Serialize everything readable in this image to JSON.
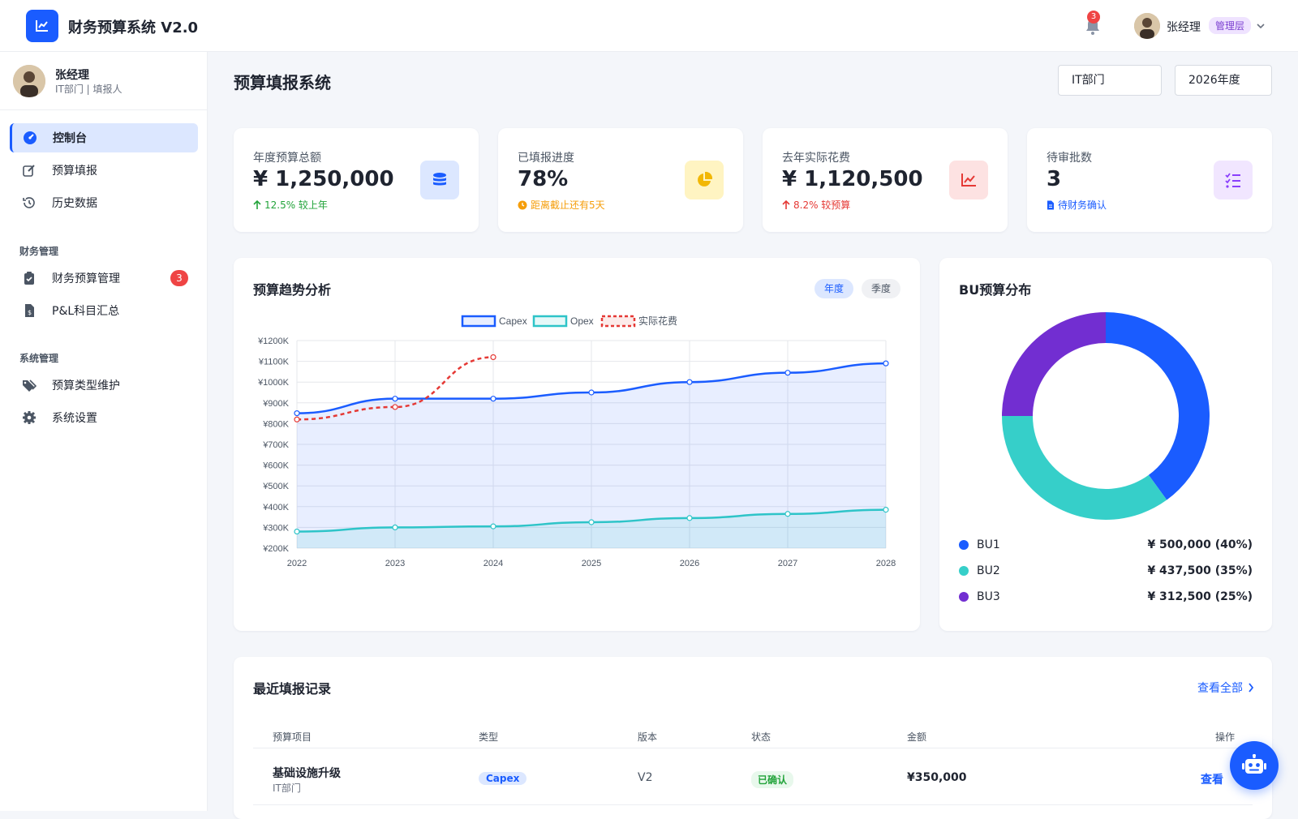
{
  "app": {
    "title": "财务预算系统 V2.0"
  },
  "topbar": {
    "notification_count": "3",
    "user_name": "张经理",
    "role": "管理层"
  },
  "sidebar": {
    "user_name": "张经理",
    "user_sub": "IT部门 | 填报人",
    "items": [
      {
        "label": "控制台",
        "icon": "dashboard-icon",
        "active": true
      },
      {
        "label": "预算填报",
        "icon": "edit-icon"
      },
      {
        "label": "历史数据",
        "icon": "history-icon"
      }
    ],
    "sections": [
      {
        "title": "财务管理",
        "items": [
          {
            "label": "财务预算管理",
            "icon": "clipboard-check-icon",
            "badge": "3"
          },
          {
            "label": "P&L科目汇总",
            "icon": "file-invoice-icon"
          }
        ]
      },
      {
        "title": "系统管理",
        "items": [
          {
            "label": "预算类型维护",
            "icon": "tags-icon"
          },
          {
            "label": "系统设置",
            "icon": "gear-icon"
          }
        ]
      }
    ]
  },
  "header": {
    "title": "预算填报系统",
    "department": "IT部门",
    "year": "2026年度"
  },
  "stats": [
    {
      "label": "年度预算总额",
      "value": "¥ 1,250,000",
      "foot": "12.5% 较上年",
      "foot_color": "#22a33a",
      "icon": "coins-icon",
      "icon_bg": "#dce7ff",
      "icon_color": "#1a5cff"
    },
    {
      "label": "已填报进度",
      "value": "78%",
      "foot": "距离截止还有5天",
      "foot_color": "#f59e0b",
      "icon": "pie-icon",
      "icon_bg": "#fff4c2",
      "icon_color": "#f2b705"
    },
    {
      "label": "去年实际花费",
      "value": "¥ 1,120,500",
      "foot": "8.2% 较预算",
      "foot_color": "#e53935",
      "icon": "line-chart-icon",
      "icon_bg": "#fde2e2",
      "icon_color": "#e53935"
    },
    {
      "label": "待审批数",
      "value": "3",
      "foot": "待财务确认",
      "foot_color": "#1a5cff",
      "icon": "task-list-icon",
      "icon_bg": "#f1e6ff",
      "icon_color": "#8a3ffc"
    }
  ],
  "trend": {
    "title": "预算趋势分析",
    "toggle": {
      "yearly": "年度",
      "quarterly": "季度"
    }
  },
  "chart_data": [
    {
      "type": "line",
      "x": [
        "2022",
        "2023",
        "2024",
        "2025",
        "2026",
        "2027",
        "2028"
      ],
      "ylim": [
        200,
        1200
      ],
      "y_ticks": [
        "¥200K",
        "¥300K",
        "¥400K",
        "¥500K",
        "¥600K",
        "¥700K",
        "¥800K",
        "¥900K",
        "¥1000K",
        "¥1100K",
        "¥1200K"
      ],
      "legend_placement": "top-center",
      "grid": true,
      "series": [
        {
          "name": "Capex",
          "color": "#1a5cff",
          "values": [
            850,
            920,
            920,
            950,
            1000,
            1045,
            1090
          ]
        },
        {
          "name": "Opex",
          "color": "#2ec4c8",
          "values": [
            280,
            300,
            305,
            325,
            345,
            365,
            385
          ]
        },
        {
          "name": "实际花费",
          "color": "#e53935",
          "values": [
            820,
            880,
            1120
          ]
        }
      ]
    },
    {
      "type": "pie",
      "title": "BU预算分布",
      "labels": [
        "BU1",
        "BU2",
        "BU3"
      ],
      "values": [
        500000,
        437500,
        312500
      ],
      "colors": [
        "#1a5cff",
        "#36cfc9",
        "#722ed1"
      ]
    }
  ],
  "bu": {
    "title": "BU预算分布",
    "rows": [
      {
        "label": "BU1",
        "value": "¥ 500,000 (40%)"
      },
      {
        "label": "BU2",
        "value": "¥ 437,500 (35%)"
      },
      {
        "label": "BU3",
        "value": "¥ 312,500 (25%)"
      }
    ]
  },
  "records": {
    "title": "最近填报记录",
    "view_all": "查看全部",
    "columns": [
      "预算项目",
      "类型",
      "版本",
      "状态",
      "金额",
      "操作"
    ],
    "rows": [
      {
        "name": "基础设施升级",
        "dept": "IT部门",
        "type": "Capex",
        "version": "V2",
        "status": "已确认",
        "amount": "¥350,000",
        "action": "查看"
      }
    ]
  }
}
